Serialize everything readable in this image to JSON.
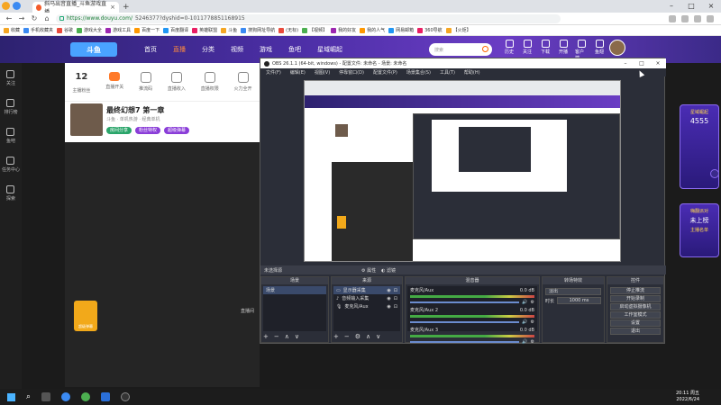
{
  "browser": {
    "tab_title": "斜马出音直播_斗鱼游戏直播...",
    "url_host": "https://www.douyu.com/",
    "url_path": "5246377?dyshid=0-1011778851168915",
    "bookmarks": [
      "收藏",
      "手机收藏夹",
      "谷歌",
      "游戏大全",
      "游戏工具",
      "百度一下",
      "百度翻译",
      "英雄联盟",
      "斗鱼",
      "搜狗网址导航",
      "(无标)",
      "【视频】",
      "我的好友",
      "我的人气",
      "网易邮箱",
      "360导航",
      "【火炬】"
    ]
  },
  "douyu": {
    "nav": [
      "首页",
      "直播",
      "分类",
      "视频",
      "游戏",
      "鱼吧",
      "星域崛起"
    ],
    "active_nav": "直播",
    "search_placeholder": "搜索",
    "icons": [
      "历史",
      "关注",
      "下载",
      "开播",
      "客户端",
      "鱼翅"
    ],
    "stats": [
      {
        "num": "12",
        "label": "主播粉丝"
      },
      {
        "num": "",
        "label": "直播开关"
      },
      {
        "num": "",
        "label": "推流码"
      },
      {
        "num": "",
        "label": "直播收入"
      },
      {
        "num": "",
        "label": "直播权限"
      },
      {
        "num": "",
        "label": "火力全开"
      }
    ],
    "anchor_title": "最终幻想7 第一章",
    "anchor_sub": "斗鱼 · 单机热游 · 经典单机",
    "anchor_fans": "房间分享",
    "btn1": "粉丝特权",
    "btn2": "超级弹幕",
    "btn3": "直播间有礼",
    "gift_label": "超级弹幕",
    "side_label": "直播间",
    "left_nav": [
      "关注",
      "排行榜",
      "鱼吧",
      "任务中心",
      "探索"
    ],
    "promo1": "星域崛起",
    "promo2": "4555",
    "promo3": "嗨翻派对",
    "promo4": "未上榜",
    "promo5": "主播名单"
  },
  "obs": {
    "title": "OBS 26.1.1 (64-bit, windows) - 配置文件: 未命名 - 场景: 未命名",
    "menu": [
      "文件(F)",
      "编辑(E)",
      "视图(V)",
      "停靠窗口(D)",
      "配置文件(P)",
      "场景集合(S)",
      "工具(T)",
      "帮助(H)"
    ],
    "dockbar_left": "未选择源",
    "dockbar_props": "属性",
    "dockbar_filters": "滤镜",
    "docks": {
      "scenes": "场景",
      "sources": "来源",
      "mixer": "混音器",
      "transitions": "转场特效",
      "controls": "控件"
    },
    "scene_item": "场景",
    "sources_items": [
      "显示器采集",
      "音频输入采集",
      "麦克风/Aux"
    ],
    "mixer_items": [
      "麦克风/Aux",
      "麦克风/Aux 2",
      "麦克风/Aux 3"
    ],
    "mixer_db": "0.0 dB",
    "transition_type": "淡出",
    "duration_label": "时长",
    "duration_value": "1000 ms",
    "controls": [
      "停止推流",
      "开始录制",
      "启动虚拟摄像机",
      "工作室模式",
      "设置",
      "退出"
    ]
  },
  "taskbar": {
    "time": "20:11 周五",
    "date": "2022/6/24"
  }
}
